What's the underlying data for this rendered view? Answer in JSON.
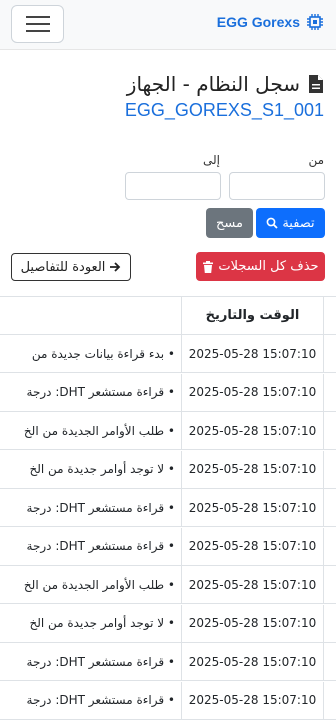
{
  "navbar": {
    "brand": "EGG Gorexs"
  },
  "page": {
    "title": "سجل النظام - الجهاز",
    "device_id": "EGG_GOREXS_S1_001"
  },
  "filter": {
    "from_label": "من",
    "to_label": "إلى",
    "from_value": "",
    "to_value": "",
    "filter_button": "تصفية",
    "clear_button": "مسح"
  },
  "actions": {
    "delete_all": "حذف كل السجلات",
    "back": "العودة للتفاصيل"
  },
  "table": {
    "header_time": "الوقت والتاريخ",
    "rows": [
      {
        "time": "2025-05-28 15:07:10",
        "message": "• بدء قراءة بيانات جديدة من"
      },
      {
        "time": "2025-05-28 15:07:10",
        "message": "• قراءة مستشعر DHT: درجة"
      },
      {
        "time": "2025-05-28 15:07:10",
        "message": "• طلب الأوامر الجديدة من الخ"
      },
      {
        "time": "2025-05-28 15:07:10",
        "message": "• لا توجد أوامر جديدة من الخ"
      },
      {
        "time": "2025-05-28 15:07:10",
        "message": "• قراءة مستشعر DHT: درجة"
      },
      {
        "time": "2025-05-28 15:07:10",
        "message": "• قراءة مستشعر DHT: درجة"
      },
      {
        "time": "2025-05-28 15:07:10",
        "message": "• طلب الأوامر الجديدة من الخ"
      },
      {
        "time": "2025-05-28 15:07:10",
        "message": "• لا توجد أوامر جديدة من الخ"
      },
      {
        "time": "2025-05-28 15:07:10",
        "message": "• قراءة مستشعر DHT: درجة"
      },
      {
        "time": "2025-05-28 15:07:10",
        "message": "• قراءة مستشعر DHT: درجة"
      }
    ]
  }
}
